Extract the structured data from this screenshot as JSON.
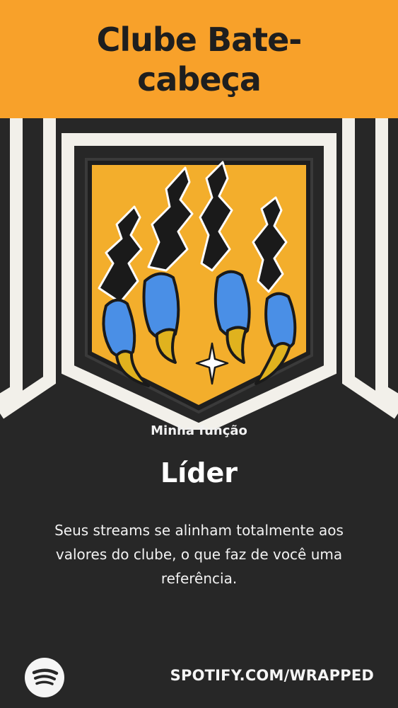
{
  "header": {
    "title": "Clube Bate-cabeça",
    "background_color": "#F8A12A"
  },
  "badge": {
    "icon": "claw-crest-icon",
    "shield_color": "#F3AE2C",
    "claw_color": "#4A8FE6",
    "talon_color": "#E0B21E"
  },
  "role": {
    "caption": "Minha função",
    "title": "Líder",
    "description": "Seus streams se alinham totalmente aos valores do clube, o que faz de você uma referência."
  },
  "footer": {
    "logo_icon": "spotify-logo-icon",
    "url": "SPOTIFY.COM/WRAPPED"
  }
}
